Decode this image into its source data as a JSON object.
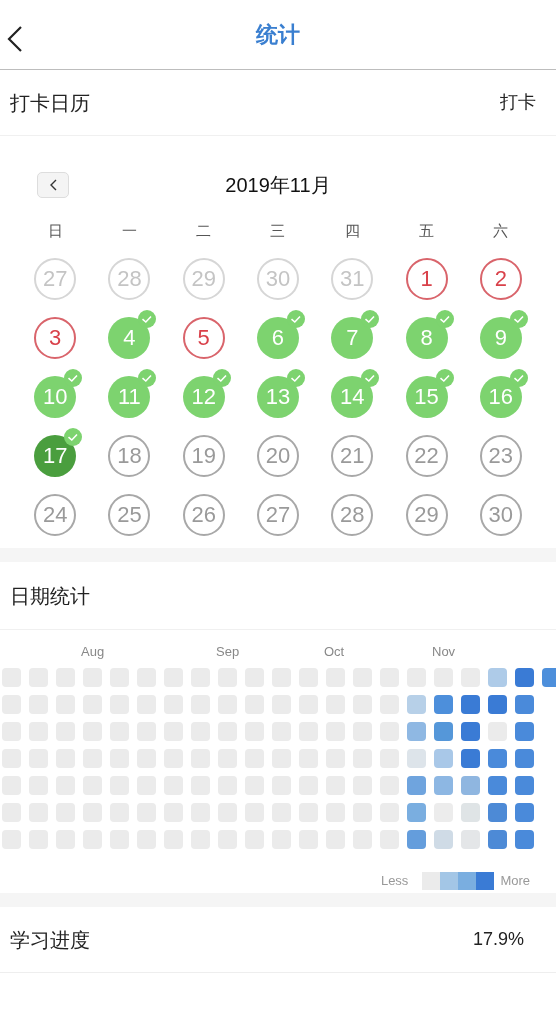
{
  "nav": {
    "title": "统计"
  },
  "checkin_section": {
    "title": "打卡日历",
    "action": "打卡"
  },
  "calendar": {
    "month_title": "2019年11月",
    "weekdays": [
      "日",
      "一",
      "二",
      "三",
      "四",
      "五",
      "六"
    ],
    "days": [
      {
        "label": "27",
        "kind": "other_month"
      },
      {
        "label": "28",
        "kind": "other_month"
      },
      {
        "label": "29",
        "kind": "other_month"
      },
      {
        "label": "30",
        "kind": "other_month"
      },
      {
        "label": "31",
        "kind": "other_month"
      },
      {
        "label": "1",
        "kind": "missed"
      },
      {
        "label": "2",
        "kind": "missed"
      },
      {
        "label": "3",
        "kind": "missed"
      },
      {
        "label": "4",
        "kind": "checked"
      },
      {
        "label": "5",
        "kind": "missed"
      },
      {
        "label": "6",
        "kind": "checked"
      },
      {
        "label": "7",
        "kind": "checked"
      },
      {
        "label": "8",
        "kind": "checked"
      },
      {
        "label": "9",
        "kind": "checked"
      },
      {
        "label": "10",
        "kind": "checked"
      },
      {
        "label": "11",
        "kind": "checked"
      },
      {
        "label": "12",
        "kind": "checked"
      },
      {
        "label": "13",
        "kind": "checked"
      },
      {
        "label": "14",
        "kind": "checked"
      },
      {
        "label": "15",
        "kind": "checked"
      },
      {
        "label": "16",
        "kind": "checked"
      },
      {
        "label": "17",
        "kind": "today"
      },
      {
        "label": "18",
        "kind": "future"
      },
      {
        "label": "19",
        "kind": "future"
      },
      {
        "label": "20",
        "kind": "future"
      },
      {
        "label": "21",
        "kind": "future"
      },
      {
        "label": "22",
        "kind": "future"
      },
      {
        "label": "23",
        "kind": "future"
      },
      {
        "label": "24",
        "kind": "future"
      },
      {
        "label": "25",
        "kind": "future"
      },
      {
        "label": "26",
        "kind": "future"
      },
      {
        "label": "27",
        "kind": "future"
      },
      {
        "label": "28",
        "kind": "future"
      },
      {
        "label": "29",
        "kind": "future"
      },
      {
        "label": "30",
        "kind": "future"
      }
    ]
  },
  "date_stats": {
    "title": "日期统计",
    "weeks": [
      {
        "days": [
          {
            "color": "#ebebeb"
          },
          {
            "color": "#ebebeb"
          },
          {
            "color": "#ebebeb"
          },
          {
            "color": "#ebebeb"
          },
          {
            "color": "#ebebeb"
          },
          {
            "color": "#ebebeb"
          },
          {
            "color": "#ebebeb"
          }
        ]
      },
      {
        "days": [
          {
            "color": "#ebebeb"
          },
          {
            "color": "#ebebeb"
          },
          {
            "color": "#ebebeb"
          },
          {
            "color": "#ebebeb"
          },
          {
            "color": "#ebebeb"
          },
          {
            "color": "#ebebeb"
          },
          {
            "color": "#ebebeb"
          }
        ]
      },
      {
        "days": [
          {
            "color": "#ebebeb"
          },
          {
            "color": "#ebebeb"
          },
          {
            "color": "#ebebeb"
          },
          {
            "color": "#ebebeb"
          },
          {
            "color": "#ebebeb"
          },
          {
            "color": "#ebebeb"
          },
          {
            "color": "#ebebeb"
          }
        ]
      },
      {
        "month": "Aug",
        "days": [
          {
            "color": "#ebebeb"
          },
          {
            "color": "#ebebeb"
          },
          {
            "color": "#ebebeb"
          },
          {
            "color": "#ebebeb"
          },
          {
            "color": "#ebebeb"
          },
          {
            "color": "#ebebeb"
          },
          {
            "color": "#ebebeb"
          }
        ]
      },
      {
        "days": [
          {
            "color": "#ebebeb"
          },
          {
            "color": "#ebebeb"
          },
          {
            "color": "#ebebeb"
          },
          {
            "color": "#ebebeb"
          },
          {
            "color": "#ebebeb"
          },
          {
            "color": "#ebebeb"
          },
          {
            "color": "#ebebeb"
          }
        ]
      },
      {
        "days": [
          {
            "color": "#ebebeb"
          },
          {
            "color": "#ebebeb"
          },
          {
            "color": "#ebebeb"
          },
          {
            "color": "#ebebeb"
          },
          {
            "color": "#ebebeb"
          },
          {
            "color": "#ebebeb"
          },
          {
            "color": "#ebebeb"
          }
        ]
      },
      {
        "days": [
          {
            "color": "#ebebeb"
          },
          {
            "color": "#ebebeb"
          },
          {
            "color": "#ebebeb"
          },
          {
            "color": "#ebebeb"
          },
          {
            "color": "#ebebeb"
          },
          {
            "color": "#ebebeb"
          },
          {
            "color": "#ebebeb"
          }
        ]
      },
      {
        "days": [
          {
            "color": "#ebebeb"
          },
          {
            "color": "#ebebeb"
          },
          {
            "color": "#ebebeb"
          },
          {
            "color": "#ebebeb"
          },
          {
            "color": "#ebebeb"
          },
          {
            "color": "#ebebeb"
          },
          {
            "color": "#ebebeb"
          }
        ]
      },
      {
        "month": "Sep",
        "days": [
          {
            "color": "#ebebeb"
          },
          {
            "color": "#ebebeb"
          },
          {
            "color": "#ebebeb"
          },
          {
            "color": "#ebebeb"
          },
          {
            "color": "#ebebeb"
          },
          {
            "color": "#ebebeb"
          },
          {
            "color": "#ebebeb"
          }
        ]
      },
      {
        "days": [
          {
            "color": "#ebebeb"
          },
          {
            "color": "#ebebeb"
          },
          {
            "color": "#ebebeb"
          },
          {
            "color": "#ebebeb"
          },
          {
            "color": "#ebebeb"
          },
          {
            "color": "#ebebeb"
          },
          {
            "color": "#ebebeb"
          }
        ]
      },
      {
        "days": [
          {
            "color": "#ebebeb"
          },
          {
            "color": "#ebebeb"
          },
          {
            "color": "#ebebeb"
          },
          {
            "color": "#ebebeb"
          },
          {
            "color": "#ebebeb"
          },
          {
            "color": "#ebebeb"
          },
          {
            "color": "#ebebeb"
          }
        ]
      },
      {
        "days": [
          {
            "color": "#ebebeb"
          },
          {
            "color": "#ebebeb"
          },
          {
            "color": "#ebebeb"
          },
          {
            "color": "#ebebeb"
          },
          {
            "color": "#ebebeb"
          },
          {
            "color": "#ebebeb"
          },
          {
            "color": "#ebebeb"
          }
        ]
      },
      {
        "month": "Oct",
        "days": [
          {
            "color": "#ebebeb"
          },
          {
            "color": "#ebebeb"
          },
          {
            "color": "#ebebeb"
          },
          {
            "color": "#ebebeb"
          },
          {
            "color": "#ebebeb"
          },
          {
            "color": "#ebebeb"
          },
          {
            "color": "#ebebeb"
          }
        ]
      },
      {
        "days": [
          {
            "color": "#ebebeb"
          },
          {
            "color": "#ebebeb"
          },
          {
            "color": "#ebebeb"
          },
          {
            "color": "#ebebeb"
          },
          {
            "color": "#ebebeb"
          },
          {
            "color": "#ebebeb"
          },
          {
            "color": "#ebebeb"
          }
        ]
      },
      {
        "days": [
          {
            "color": "#ebebeb"
          },
          {
            "color": "#ebebeb"
          },
          {
            "color": "#ebebeb"
          },
          {
            "color": "#ebebeb"
          },
          {
            "color": "#ebebeb"
          },
          {
            "color": "#ebebeb"
          },
          {
            "color": "#ebebeb"
          }
        ]
      },
      {
        "days": [
          {
            "color": "#ebebeb"
          },
          {
            "color": "#b7d0e8"
          },
          {
            "color": "#8fb8e3"
          },
          {
            "color": "#dde4ea"
          },
          {
            "color": "#6fa4de"
          },
          {
            "color": "#7aaee0"
          },
          {
            "color": "#649ddc"
          }
        ]
      },
      {
        "month": "Nov",
        "days": [
          {
            "color": "#ebebeb"
          },
          {
            "color": "#4d8fdb"
          },
          {
            "color": "#5597d9"
          },
          {
            "color": "#a9c8e8"
          },
          {
            "color": "#8db7e3"
          },
          {
            "color": "#ececec"
          },
          {
            "color": "#cfdbe6"
          }
        ]
      },
      {
        "days": [
          {
            "color": "#ebebeb"
          },
          {
            "color": "#3a7bd5"
          },
          {
            "color": "#3a7bd5"
          },
          {
            "color": "#3a7bd5"
          },
          {
            "color": "#8fb6e0"
          },
          {
            "color": "#dfe4e6"
          },
          {
            "color": "#e4e6e8"
          }
        ]
      },
      {
        "days": [
          {
            "color": "#aecbe8"
          },
          {
            "color": "#3a7bd5"
          },
          {
            "color": "#ebebeb"
          },
          {
            "color": "#4a8ada"
          },
          {
            "color": "#4a8ada"
          },
          {
            "color": "#4d8ad6"
          },
          {
            "color": "#4d8ad6"
          }
        ]
      },
      {
        "days": [
          {
            "color": "#3a7bd5"
          },
          {
            "color": "#4a8ada"
          },
          {
            "color": "#4a8ada"
          },
          {
            "color": "#4a8ada"
          },
          {
            "color": "#4a8ada"
          },
          {
            "color": "#4a8ada"
          },
          {
            "color": "#4a8ada"
          }
        ]
      },
      {
        "days": [
          {
            "color": "#4d8fdb"
          }
        ]
      }
    ],
    "legend": {
      "less": "Less",
      "more": "More",
      "swatches": [
        {
          "color": "#ebebeb"
        },
        {
          "color": "#a3c6e6"
        },
        {
          "color": "#7aaee0"
        },
        {
          "color": "#3a7bd5"
        }
      ]
    }
  },
  "progress": {
    "title": "学习进度",
    "value": "17.9%"
  }
}
